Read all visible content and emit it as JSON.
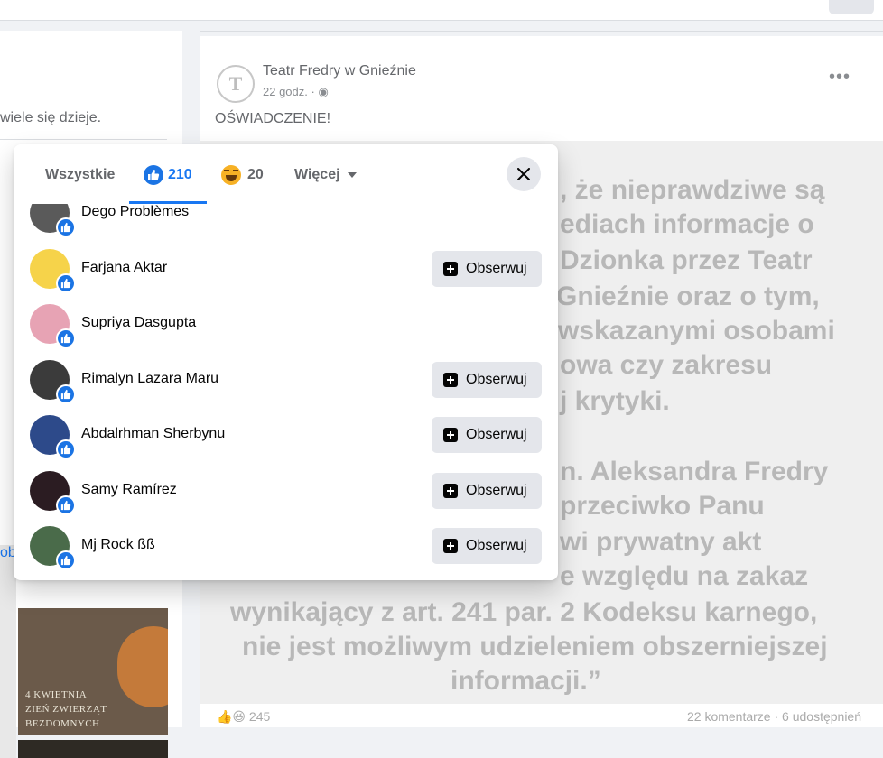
{
  "background": {
    "left_snippet": "wiele się dzieje.",
    "left_blue_text": "ob",
    "left_image_lines": [
      "4 KWIETNIA",
      "ZIEŃ ZWIERZĄT",
      "BEZDOMNYCH"
    ],
    "post": {
      "page_name": "Teatr Fredry w Gnieźnie",
      "time": "22 godz. ·",
      "text": "OŚWIADCZENIE!",
      "image_quote_lines": [
        ", że nieprawdziwe są",
        "ediach informacje o",
        "Dzionka przez Teatr",
        "Gnieźnie oraz o tym,",
        "wskazanymi osobami",
        "owa czy zakresu",
        "j krytyki.",
        "",
        "n. Aleksandra Fredry",
        "przeciwko Panu",
        "wi prywatny akt",
        "e względu na zakaz",
        "wynikający z art. 241 par. 2 Kodeksu karnego,",
        "nie jest możliwym udzieleniem obszerniejszej",
        "informacji.”"
      ],
      "reaction_count": "245",
      "comments_shares": "22 komentarze · 6 udostępnień"
    }
  },
  "modal": {
    "tabs": {
      "all_label": "Wszystkie",
      "like_count": "210",
      "haha_count": "20",
      "more_label": "Więcej"
    },
    "people": [
      {
        "name": "Dego Problèmes",
        "follow": false,
        "avatar_color": "#5a5a5a"
      },
      {
        "name": "Farjana Aktar",
        "follow": true,
        "avatar_color": "#f6d34a"
      },
      {
        "name": "Supriya Dasgupta",
        "follow": false,
        "avatar_color": "#e7a3b4"
      },
      {
        "name": "Rimalyn Lazara Maru",
        "follow": true,
        "avatar_color": "#3b3b3b"
      },
      {
        "name": "Abdalrhman Sherbynu",
        "follow": true,
        "avatar_color": "#2d4a8a"
      },
      {
        "name": "Samy Ramírez",
        "follow": true,
        "avatar_color": "#2b1c22"
      },
      {
        "name": "Mj Rock ßß",
        "follow": true,
        "avatar_color": "#4a6b4a"
      }
    ],
    "follow_label": "Obserwuj"
  },
  "colors": {
    "accent": "#1877f2",
    "button_bg": "#e4e6eb",
    "secondary_text": "#65676b"
  }
}
